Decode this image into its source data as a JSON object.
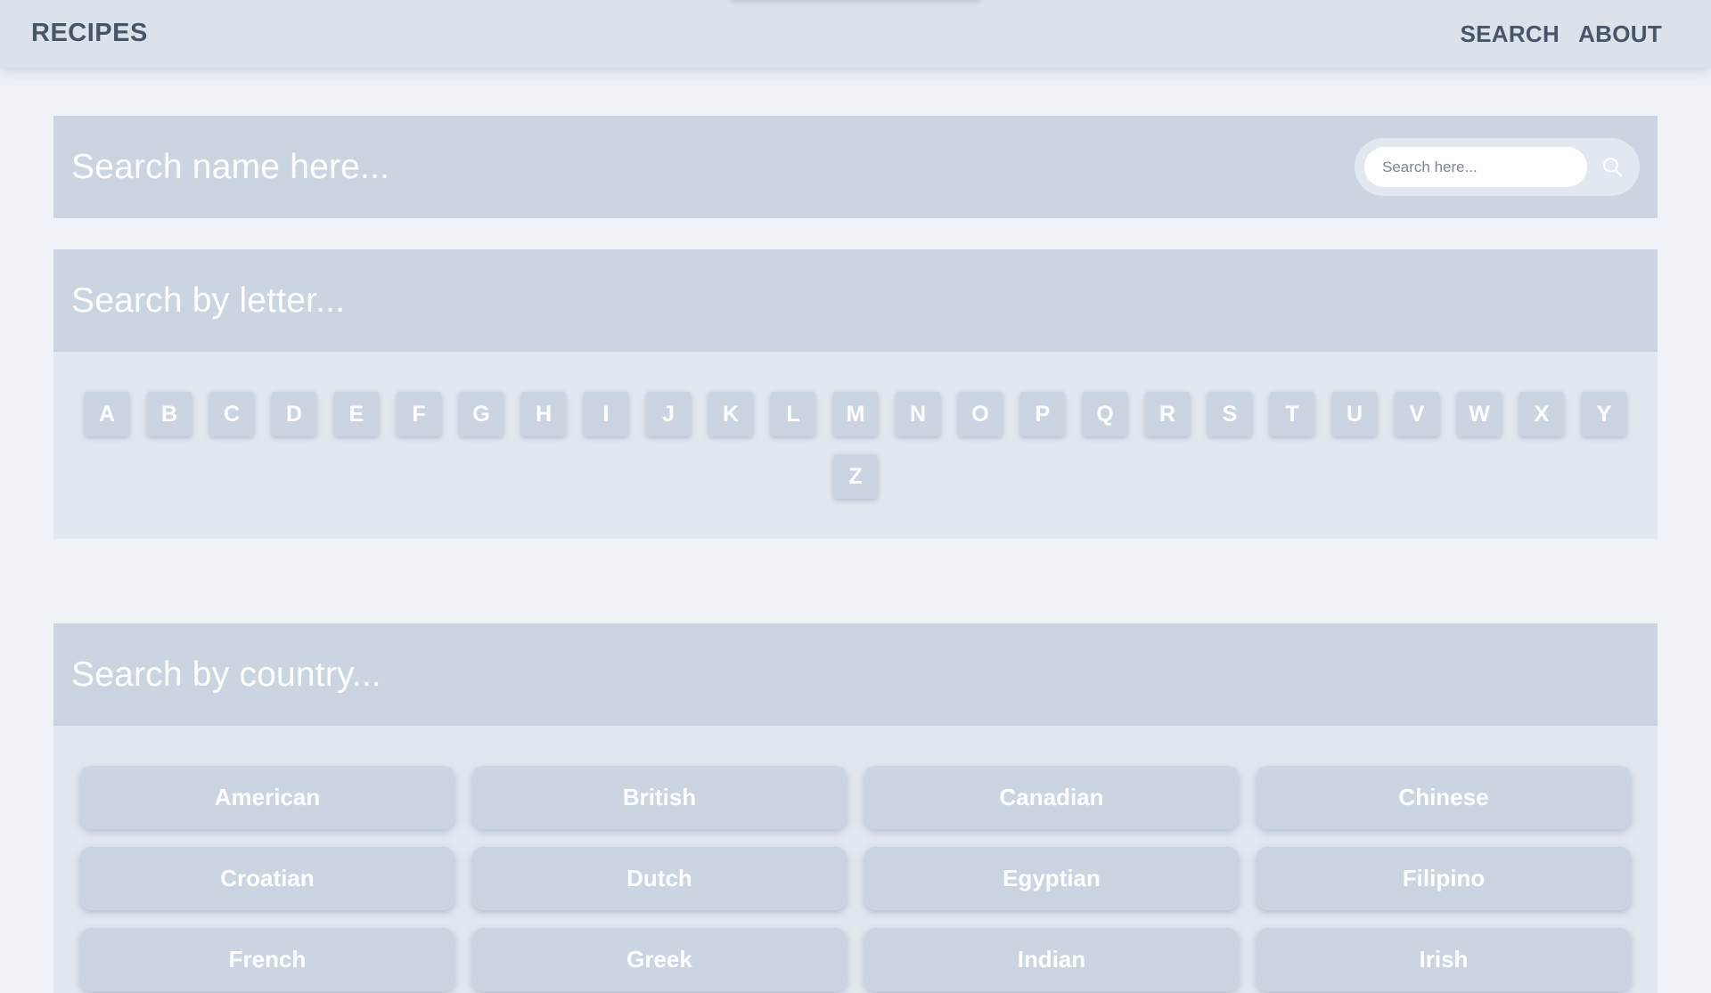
{
  "navbar": {
    "brand": "RECIPES",
    "links": [
      "SEARCH",
      "ABOUT"
    ]
  },
  "name_search": {
    "title": "Search name here...",
    "placeholder": "Search here..."
  },
  "letter_search": {
    "title": "Search by letter...",
    "letters": [
      "A",
      "B",
      "C",
      "D",
      "E",
      "F",
      "G",
      "H",
      "I",
      "J",
      "K",
      "L",
      "M",
      "N",
      "O",
      "P",
      "Q",
      "R",
      "S",
      "T",
      "U",
      "V",
      "W",
      "X",
      "Y",
      "Z"
    ]
  },
  "country_search": {
    "title": "Search by country...",
    "countries": [
      "American",
      "British",
      "Canadian",
      "Chinese",
      "Croatian",
      "Dutch",
      "Egyptian",
      "Filipino",
      "French",
      "Greek",
      "Indian",
      "Irish"
    ]
  },
  "colors": {
    "navbar_bg": "#dbe2ea",
    "panel_head": "#cbd5e1",
    "panel_body": "#e2e8f0",
    "page_bg": "#eff3f8",
    "text_dark": "#475569"
  },
  "icons": {
    "search": "magnifier-icon"
  }
}
